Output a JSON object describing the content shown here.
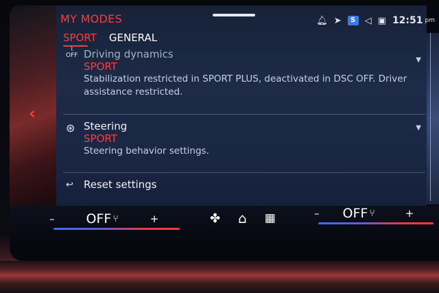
{
  "header": {
    "title": "MY MODES",
    "tabs": [
      {
        "label": "SPORT",
        "active": true
      },
      {
        "label": "GENERAL",
        "active": false
      }
    ]
  },
  "status_bar": {
    "icons": [
      "bell-icon",
      "location-arrow-icon",
      "s-box-icon",
      "volume-icon",
      "profile-icon"
    ],
    "s_box_letter": "S",
    "time": "12:51",
    "ampm": "pm"
  },
  "settings": {
    "items": [
      {
        "name": "Driving dynamics",
        "value": "SPORT",
        "description": "Stabilization restricted in SPORT PLUS, deactivated in DSC OFF. Driver assistance restricted.",
        "icon": "dsc-off-icon",
        "icon_label": "OFF"
      },
      {
        "name": "Steering",
        "value": "SPORT",
        "description": "Steering behavior settings.",
        "icon": "steering-wheel-icon"
      },
      {
        "name": "Reset settings",
        "icon": "reset-icon"
      }
    ]
  },
  "climate": {
    "left": {
      "minus": "–",
      "value": "OFF",
      "plus": "+",
      "icon": "seat-heat-icon"
    },
    "right": {
      "minus": "–",
      "value": "OFF",
      "plus": "+",
      "icon": "seat-heat-icon"
    },
    "center_icons": [
      "fan-icon",
      "home-icon",
      "apps-grid-icon"
    ]
  },
  "colors": {
    "accent": "#ff3b3b",
    "panel": "#1d2b48",
    "text": "#f2f3f7",
    "temp_bar_start": "#3a6ef0",
    "temp_bar_end": "#ff3b3b"
  }
}
